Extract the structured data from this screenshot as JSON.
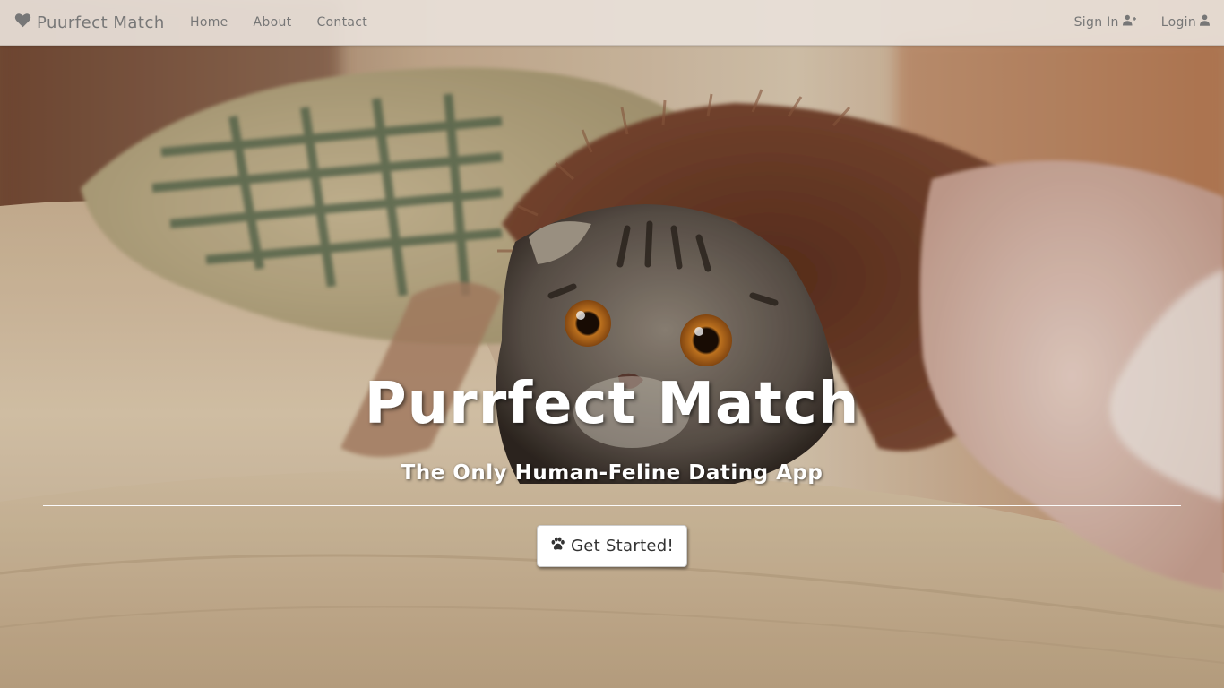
{
  "navbar": {
    "brand_icon": "heart-icon",
    "brand": "Puurfect Match",
    "links": [
      {
        "label": "Home"
      },
      {
        "label": "About"
      },
      {
        "label": "Contact"
      }
    ],
    "right_links": [
      {
        "label": "Sign In",
        "icon": "user-plus-icon"
      },
      {
        "label": "Login",
        "icon": "user-icon"
      }
    ]
  },
  "hero": {
    "title": "Purrfect Match",
    "subtitle": "The Only Human-Feline Dating App",
    "cta": {
      "label": "Get Started!",
      "icon": "paw-icon"
    }
  },
  "colors": {
    "navbar_bg": "#e8e0d8",
    "nav_text": "#777777",
    "hero_text": "#ffffff",
    "button_bg": "#ffffff",
    "button_text": "#333333"
  }
}
